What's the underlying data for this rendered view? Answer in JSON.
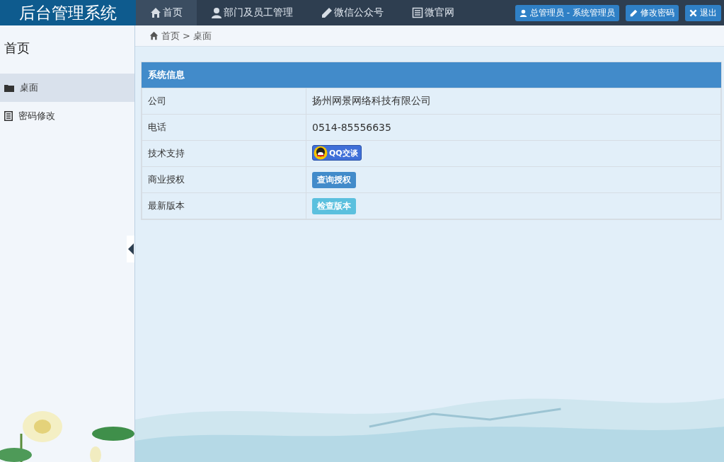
{
  "app_title": "后台管理系统",
  "nav": [
    {
      "label": "首页",
      "selected": true
    },
    {
      "label": "部门及员工管理",
      "selected": false
    },
    {
      "label": "微信公众号",
      "selected": false
    },
    {
      "label": "微官网",
      "selected": false
    }
  ],
  "user_buttons": [
    {
      "label": "总管理员 - 系统管理员"
    },
    {
      "label": "修改密码"
    },
    {
      "label": "退出"
    }
  ],
  "sidebar": {
    "title": "首页",
    "items": [
      {
        "label": "桌面",
        "selected": true
      },
      {
        "label": "密码修改",
        "selected": false
      }
    ]
  },
  "breadcrumb": {
    "separator": ">",
    "items": [
      "首页",
      "桌面"
    ]
  },
  "panel": {
    "title": "系统信息",
    "rows": [
      {
        "label": "公司",
        "kind": "text",
        "value": "扬州网景网络科技有限公司"
      },
      {
        "label": "电话",
        "kind": "text",
        "value": "0514-85556635"
      },
      {
        "label": "技术支持",
        "kind": "qq",
        "value": "QQ交谈"
      },
      {
        "label": "商业授权",
        "kind": "primary",
        "value": "查询授权"
      },
      {
        "label": "最新版本",
        "kind": "info",
        "value": "检查版本"
      }
    ]
  }
}
